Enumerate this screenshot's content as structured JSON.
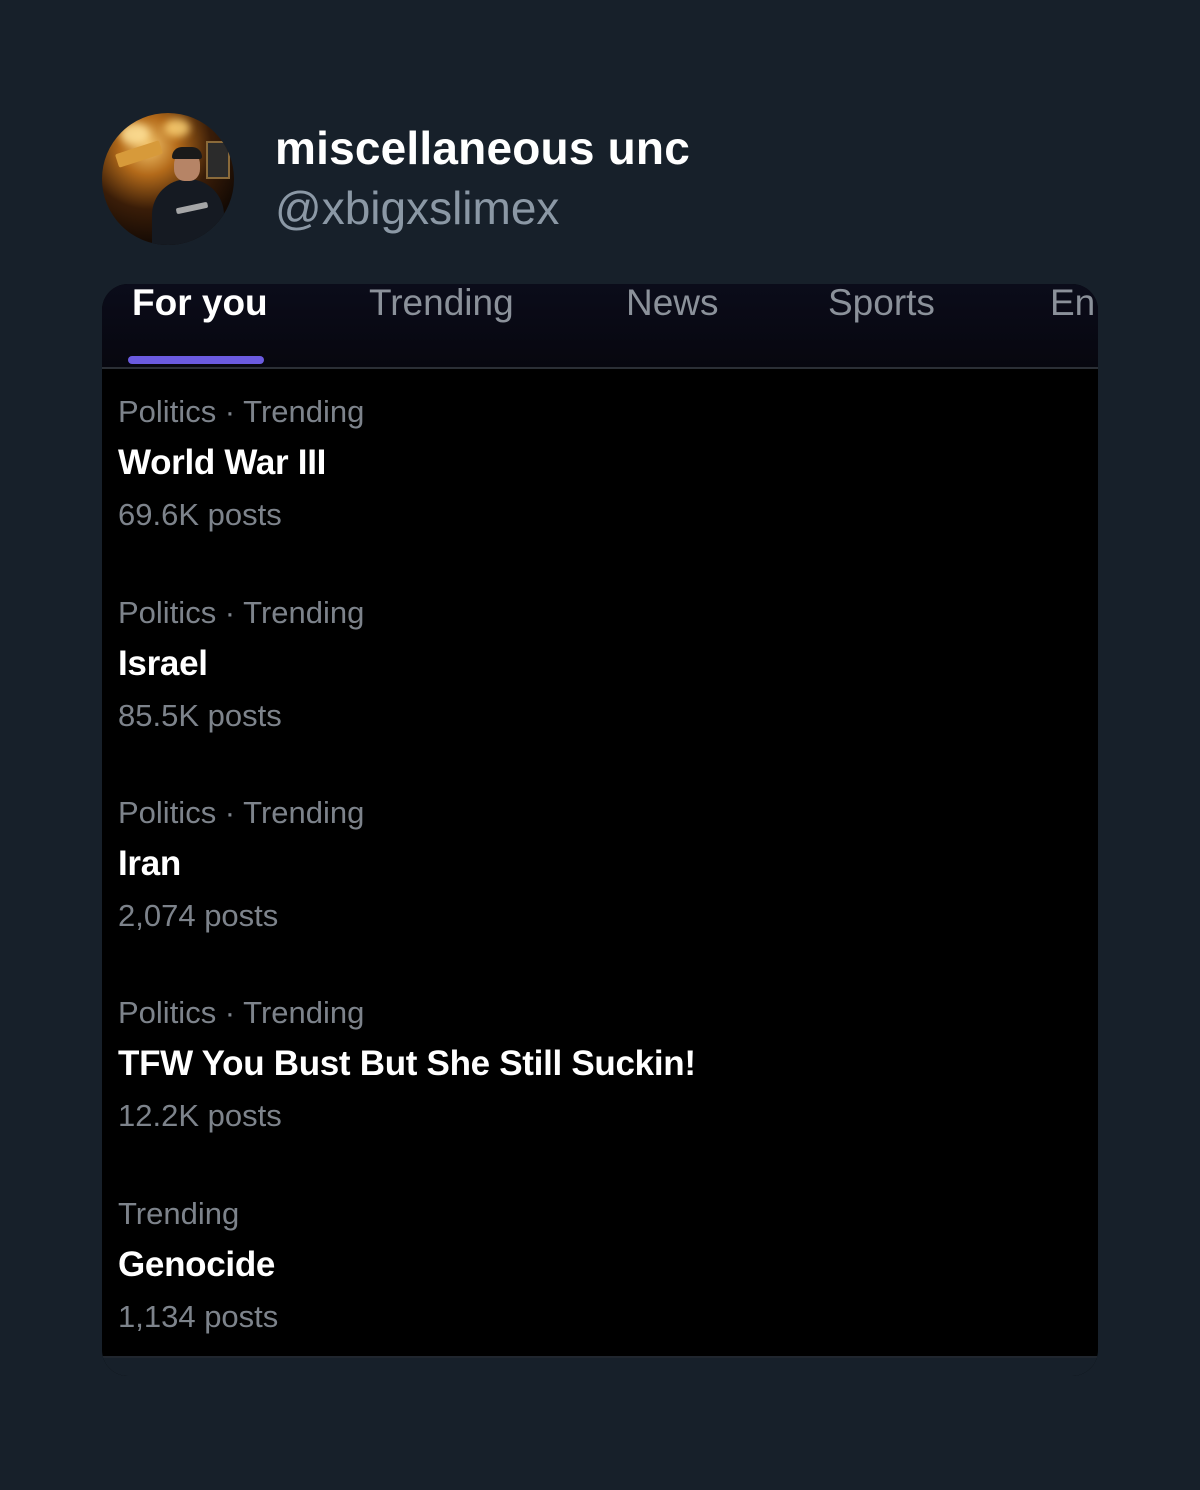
{
  "author": {
    "display_name": "miscellaneous unc",
    "handle": "@xbigxslimex"
  },
  "tabs": [
    {
      "label": "For you",
      "active": true
    },
    {
      "label": "Trending",
      "active": false
    },
    {
      "label": "News",
      "active": false
    },
    {
      "label": "Sports",
      "active": false
    },
    {
      "label": "En",
      "active": false
    }
  ],
  "trends": [
    {
      "meta": "Politics · Trending",
      "title": "World War III",
      "count": "69.6K posts"
    },
    {
      "meta": "Politics · Trending",
      "title": "Israel",
      "count": "85.5K posts"
    },
    {
      "meta": "Politics · Trending",
      "title": "Iran",
      "count": "2,074 posts"
    },
    {
      "meta": "Politics · Trending",
      "title": "TFW You Bust But She Still Suckin!",
      "count": "12.2K posts"
    },
    {
      "meta": "Trending",
      "title": "Genocide",
      "count": "1,134 posts"
    }
  ],
  "colors": {
    "page_background": "#17202a",
    "card_background": "#000000",
    "tab_indicator": "#6b5be0",
    "muted_text": "#7d838b",
    "handle_text": "#8b98a5"
  }
}
